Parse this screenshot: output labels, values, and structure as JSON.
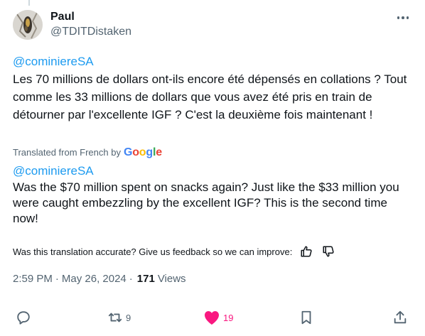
{
  "tweet": {
    "author": {
      "display_name": "Paul",
      "handle": "@TDITDistaken"
    },
    "original": {
      "mention": "@cominiereSA",
      "text": "Les 70 millions de dollars ont-ils encore été dépensés en collations ? Tout comme les 33 millions de dollars que vous avez été pris en train de détourner par l'excellente IGF ? C'est la deuxième fois maintenant !"
    },
    "translated_label": "Translated from French by",
    "translation_provider": "Google",
    "translation": {
      "mention": "@cominiereSA",
      "text": "Was the $70 million spent on snacks again? Just like the $33 million you were caught embezzling by the excellent IGF? This is the second time now!"
    },
    "feedback_prompt": "Was this translation accurate? Give us feedback so we can improve:",
    "meta": {
      "time": "2:59 PM",
      "separator": "·",
      "date": "May 26, 2024",
      "views_count": "171",
      "views_label": "Views"
    },
    "actions": {
      "replies": "",
      "retweets": "9",
      "likes": "19"
    }
  },
  "colors": {
    "accent": "#1d9bf0",
    "like": "#f91880",
    "secondary_text": "#536471",
    "primary_text": "#0f1419"
  },
  "icons": [
    "avatar-photo",
    "more-icon",
    "thumbs-up-icon",
    "thumbs-down-icon",
    "reply-icon",
    "retweet-icon",
    "heart-icon",
    "bookmark-icon",
    "share-icon"
  ]
}
